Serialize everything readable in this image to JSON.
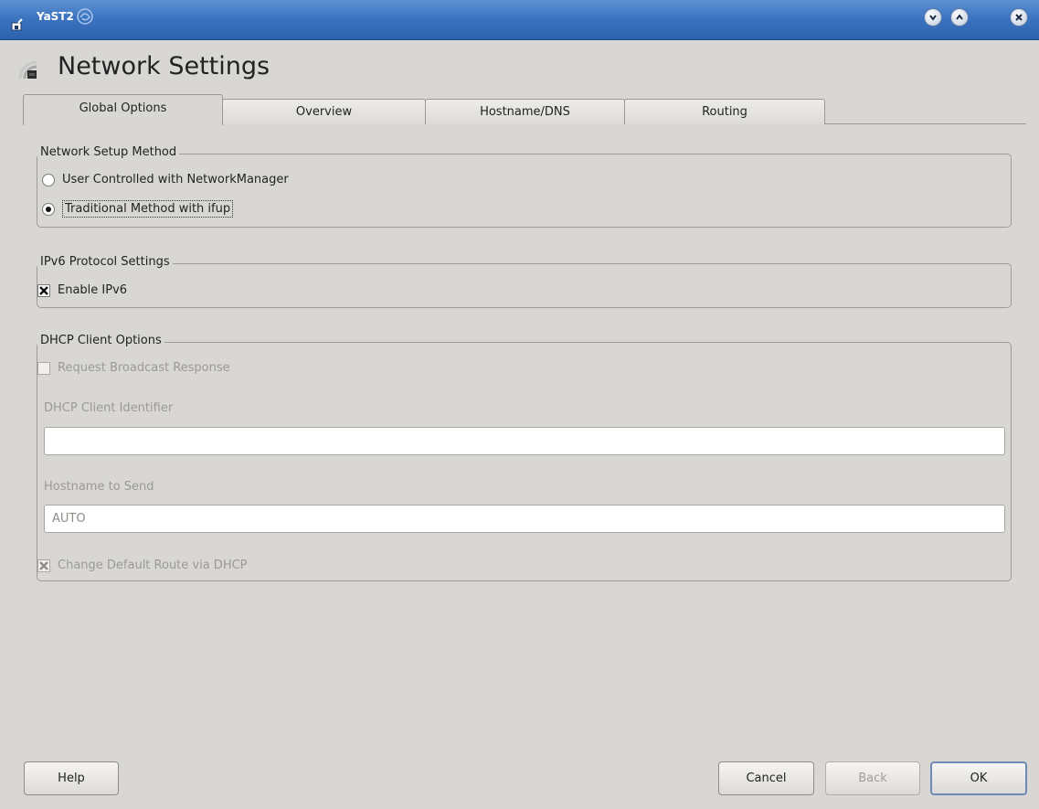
{
  "window": {
    "title": "YaST2"
  },
  "page": {
    "heading": "Network Settings"
  },
  "tabs": [
    {
      "label": "Global Options",
      "mnemonic_index": 0,
      "active": true
    },
    {
      "label": "Overview",
      "mnemonic_index": 1,
      "active": false
    },
    {
      "label": "Hostname/DNS",
      "mnemonic_index": 2,
      "active": false
    },
    {
      "label": "Routing",
      "mnemonic_index": 2,
      "active": false
    }
  ],
  "setup_method": {
    "title": "Network Setup Method",
    "options": [
      {
        "label": "User Controlled with NetworkManager",
        "selected": false
      },
      {
        "label": "Traditional Method with ifup",
        "selected": true
      }
    ]
  },
  "ipv6": {
    "title": "IPv6 Protocol Settings",
    "enable_label": "Enable IPv6",
    "enabled": true
  },
  "dhcp": {
    "title": "DHCP Client Options",
    "broadcast_label": "Request Broadcast Response",
    "broadcast_checked": false,
    "client_id_label": "DHCP Client Identifier",
    "client_id_value": "",
    "hostname_label": "Hostname to Send",
    "hostname_value": "AUTO",
    "default_route_label": "Change Default Route via DHCP",
    "default_route_checked": true
  },
  "buttons": {
    "help": "Help",
    "cancel": "Cancel",
    "back": "Back",
    "ok": "OK"
  },
  "colors": {
    "titlebar": "#3c74c0",
    "window_bg": "#d8d7d4",
    "disabled_text": "#9b9994"
  }
}
